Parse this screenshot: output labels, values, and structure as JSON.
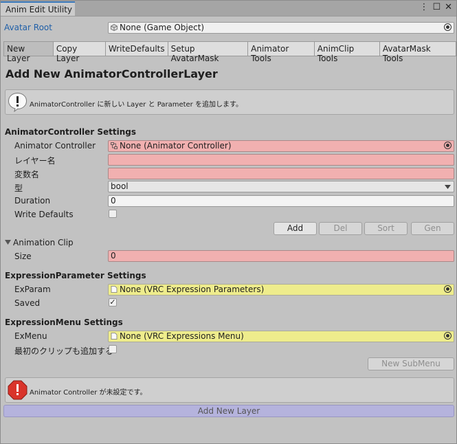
{
  "window": {
    "title": "Anim Edit Utility"
  },
  "avatar_root": {
    "label": "Avatar Root",
    "value": "None (Game Object)"
  },
  "tabs": [
    {
      "label": "New Layer"
    },
    {
      "label": "Copy Layer"
    },
    {
      "label": "WriteDefaults"
    },
    {
      "label": "Setup AvatarMask"
    },
    {
      "label": "Animator Tools"
    },
    {
      "label": "AnimClip Tools"
    },
    {
      "label": "AvatarMask Tools"
    }
  ],
  "heading": "Add New AnimatorControllerLayer",
  "info_box": {
    "text": "AnimatorController に新しい Layer と Parameter を追加します。"
  },
  "controller_settings": {
    "title": "AnimatorController Settings",
    "animator_controller_label": "Animator Controller",
    "animator_controller_value": "None (Animator Controller)",
    "layer_name_label": "レイヤー名",
    "param_name_label": "変数名",
    "type_label": "型",
    "type_value": "bool",
    "duration_label": "Duration",
    "duration_value": "0",
    "write_defaults_label": "Write Defaults",
    "buttons": {
      "add": "Add",
      "del": "Del",
      "sort": "Sort",
      "gen": "Gen"
    }
  },
  "animation_clip": {
    "title": "Animation Clip",
    "size_label": "Size",
    "size_value": "0"
  },
  "expression_param": {
    "title": "ExpressionParameter Settings",
    "exparam_label": "ExParam",
    "exparam_value": "None (VRC Expression Parameters)",
    "saved_label": "Saved",
    "saved_check": "✓"
  },
  "expression_menu": {
    "title": "ExpressionMenu Settings",
    "exmenu_label": "ExMenu",
    "exmenu_value": "None (VRC Expressions Menu)",
    "add_first_clip_label": "最初のクリップも追加する",
    "new_submenu": "New SubMenu"
  },
  "error_box": {
    "text": "Animator Controller が未設定です。"
  },
  "add_new_layer": "Add New Layer",
  "colors": {
    "accent": "#3a79bb",
    "link": "#1f5fa8",
    "error_field": "#f1b0b0",
    "warn_field": "#eeec8c",
    "primary_button": "#b5b3dd"
  }
}
